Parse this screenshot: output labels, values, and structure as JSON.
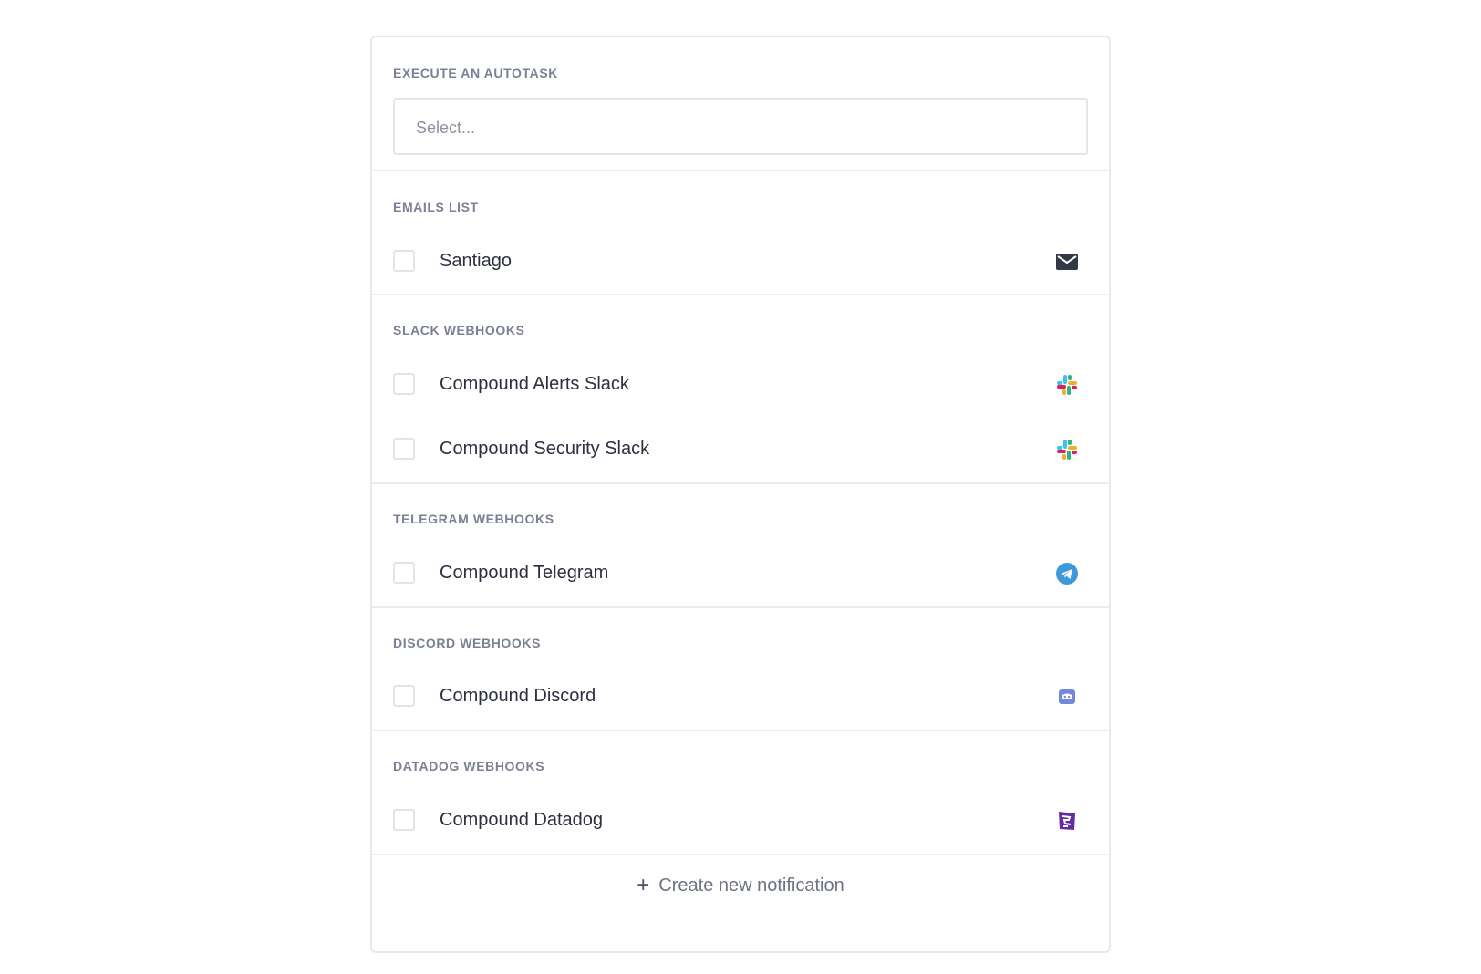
{
  "autotask": {
    "title": "EXECUTE AN AUTOTASK",
    "placeholder": "Select..."
  },
  "emails": {
    "title": "EMAILS LIST",
    "items": [
      {
        "label": "Santiago",
        "icon": "mail-icon"
      }
    ]
  },
  "slack": {
    "title": "SLACK WEBHOOKS",
    "items": [
      {
        "label": "Compound Alerts Slack",
        "icon": "slack-icon"
      },
      {
        "label": "Compound Security Slack",
        "icon": "slack-icon"
      }
    ]
  },
  "telegram": {
    "title": "TELEGRAM WEBHOOKS",
    "items": [
      {
        "label": "Compound Telegram",
        "icon": "telegram-icon"
      }
    ]
  },
  "discord": {
    "title": "DISCORD WEBHOOKS",
    "items": [
      {
        "label": "Compound Discord",
        "icon": "discord-icon"
      }
    ]
  },
  "datadog": {
    "title": "DATADOG WEBHOOKS",
    "items": [
      {
        "label": "Compound Datadog",
        "icon": "datadog-icon"
      }
    ]
  },
  "footer": {
    "create_label": "Create new notification"
  },
  "colors": {
    "border": "#e7e9ee",
    "section_title": "#7b8194",
    "text": "#2c3040",
    "telegram": "#3d9ad8",
    "discord": "#7289da",
    "datadog": "#632ca6"
  }
}
